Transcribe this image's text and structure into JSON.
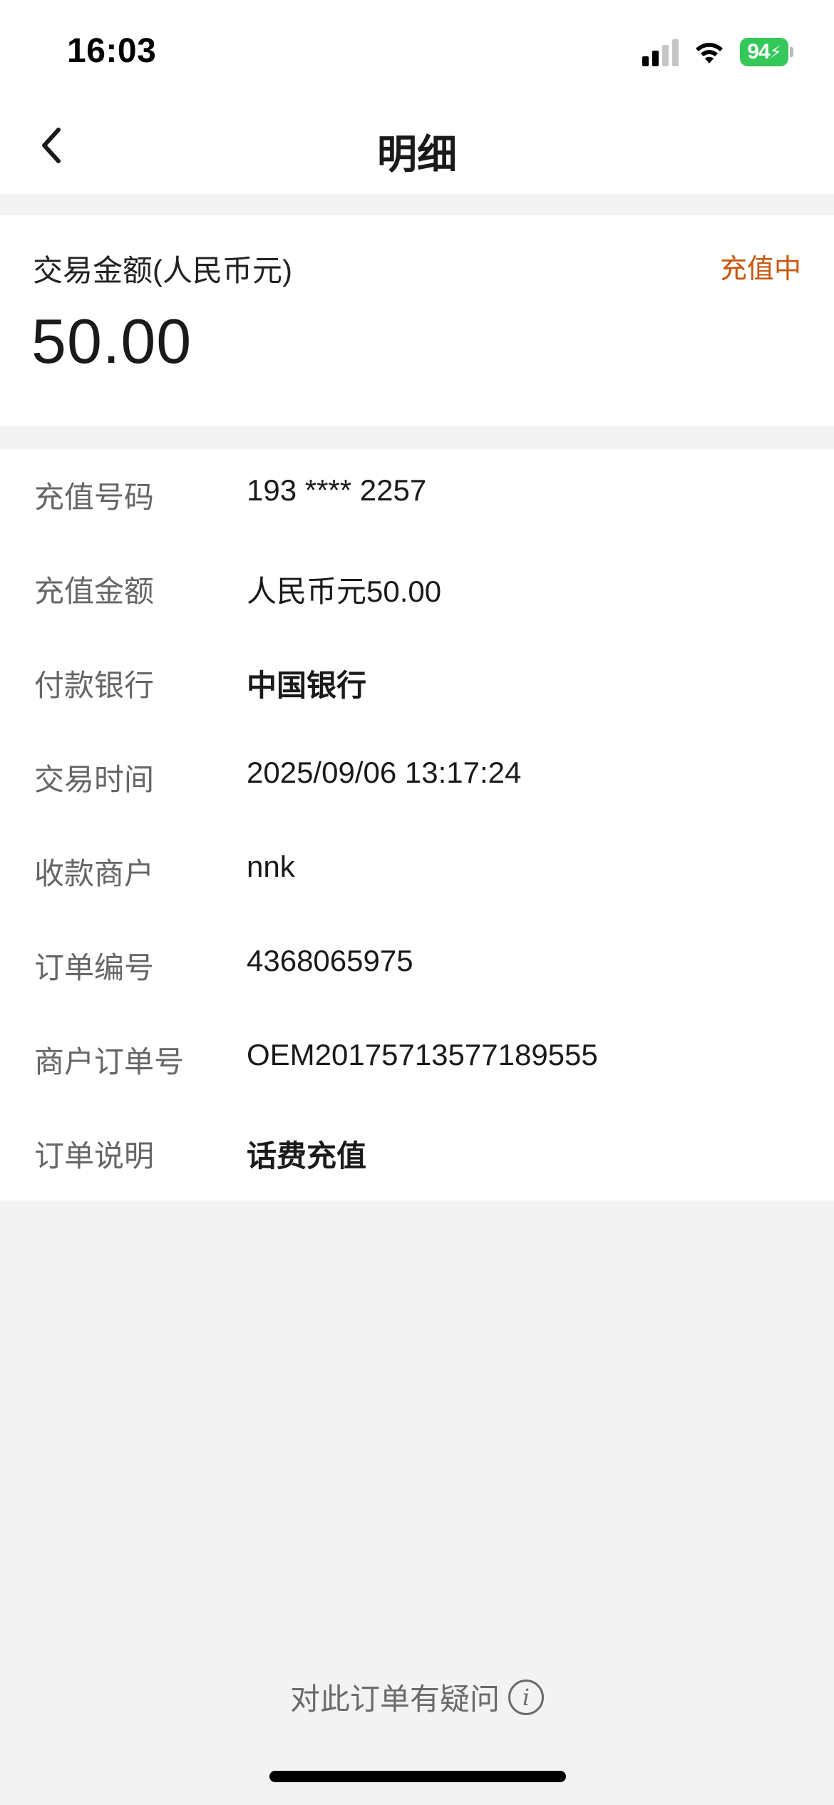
{
  "status_bar": {
    "time": "16:03",
    "battery_level": "94",
    "icons": [
      "signal-icon",
      "wifi-icon",
      "battery-charging-icon"
    ]
  },
  "nav": {
    "title": "明细",
    "back_icon": "chevron-left-icon"
  },
  "amount_card": {
    "label": "交易金额(人民币元)",
    "value": "50.00",
    "status": "充值中",
    "status_color": "#c9560e"
  },
  "details": [
    {
      "key": "充值号码",
      "value": "193 **** 2257",
      "bold": false
    },
    {
      "key": "充值金额",
      "value": "人民币元50.00",
      "bold": false
    },
    {
      "key": "付款银行",
      "value": "中国银行",
      "bold": true
    },
    {
      "key": "交易时间",
      "value": "2025/09/06 13:17:24",
      "bold": false
    },
    {
      "key": "收款商户",
      "value": "nnk",
      "bold": false
    },
    {
      "key": "订单编号",
      "value": "4368065975",
      "bold": false
    },
    {
      "key": "商户订单号",
      "value": "OEM20175713577189555",
      "bold": false
    },
    {
      "key": "订单说明",
      "value": "话费充值",
      "bold": true
    }
  ],
  "footer": {
    "link_text": "对此订单有疑问",
    "icon": "info-icon"
  },
  "colors": {
    "background": "#f3f3f3",
    "card": "#ffffff",
    "accent_status": "#c9560e",
    "battery": "#34c759"
  }
}
